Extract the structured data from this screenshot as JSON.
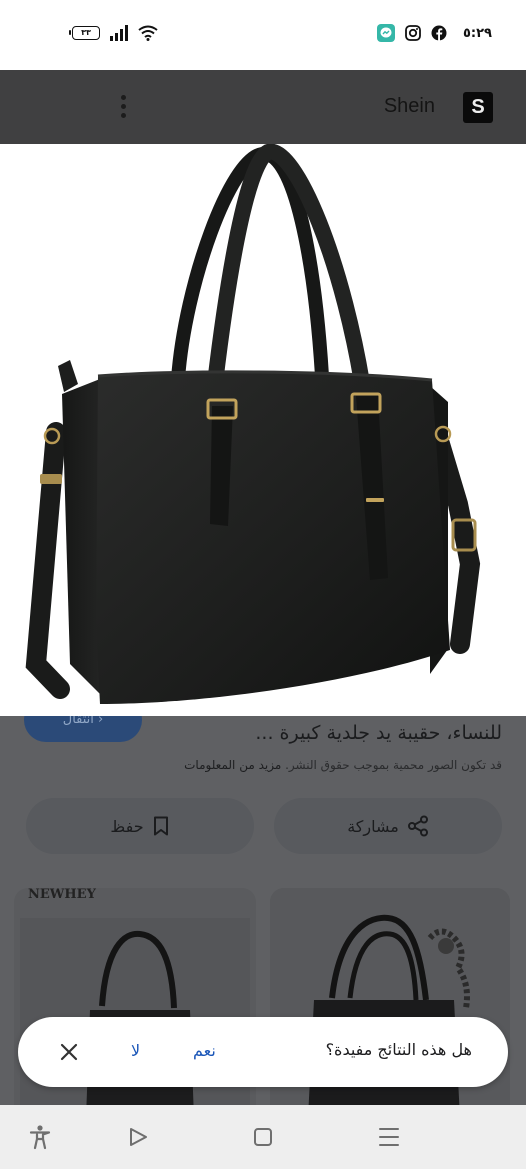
{
  "status_bar": {
    "time": "٥:٢٩",
    "battery": "٣٣",
    "icons": [
      "messenger-icon",
      "instagram-icon",
      "facebook-icon",
      "wifi-icon",
      "signal-icon",
      "battery-icon"
    ]
  },
  "header": {
    "title": "Shein",
    "logo_letter": "S"
  },
  "result": {
    "visit_label": "انتقال",
    "title": "للنساء، حقيبة يد جلدية كبيرة ...",
    "copyright_text": "قد تكون الصور محمية بموجب حقوق النشر.",
    "learn_more": "مزيد من المعلومات",
    "share_label": "مشاركة",
    "save_label": "حفظ"
  },
  "related": {
    "left_caption": "NEWHEY"
  },
  "feedback": {
    "question": "هل هذه النتائج مفيدة؟",
    "yes_label": "نعم",
    "no_label": "لا"
  },
  "colors": {
    "overlay": "#5f6063",
    "header": "#404041",
    "link_blue": "#1a56b8"
  }
}
